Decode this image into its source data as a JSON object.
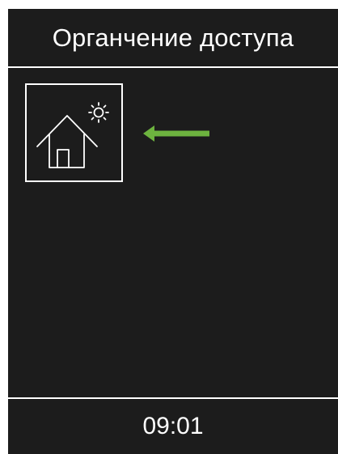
{
  "header": {
    "title": "Органчение доступа"
  },
  "tiles": [
    {
      "icon": "house-sun-icon",
      "selected": true
    }
  ],
  "indicator": {
    "icon": "arrow-left-icon",
    "color": "#6db33f"
  },
  "footer": {
    "time": "09:01"
  },
  "colors": {
    "background": "#1c1c1c",
    "foreground": "#ffffff",
    "accent": "#6db33f"
  }
}
